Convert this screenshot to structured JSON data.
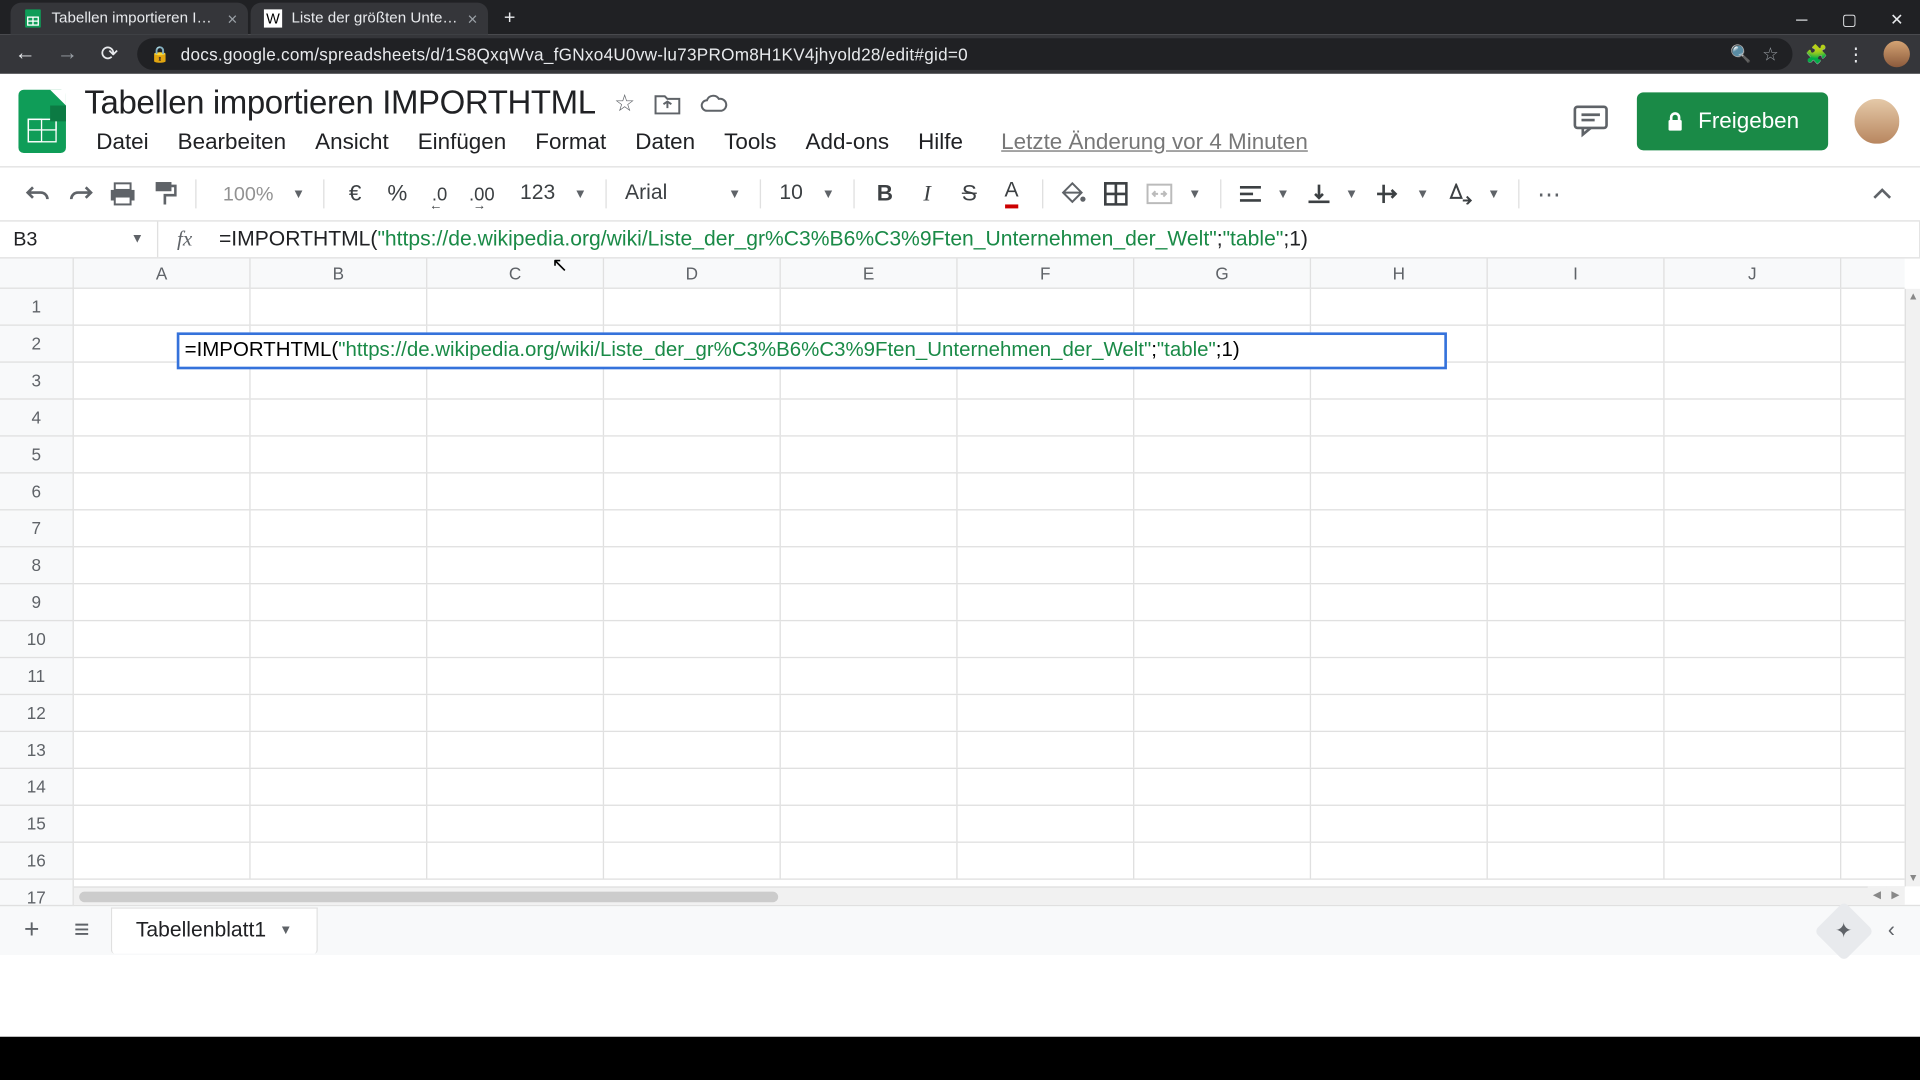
{
  "browser": {
    "tabs": [
      {
        "title": "Tabellen importieren IMPORTHT",
        "favicon": "sheets"
      },
      {
        "title": "Liste der größten Unternehmen",
        "favicon": "wiki"
      }
    ],
    "url": "docs.google.com/spreadsheets/d/1S8QxqWva_fGNxo4U0vw-lu73PROm8H1KV4jhyold28/edit#gid=0"
  },
  "header": {
    "doc_title": "Tabellen importieren IMPORTHTML",
    "menus": [
      "Datei",
      "Bearbeiten",
      "Ansicht",
      "Einfügen",
      "Format",
      "Daten",
      "Tools",
      "Add-ons",
      "Hilfe"
    ],
    "last_edit": "Letzte Änderung vor 4 Minuten",
    "share_label": "Freigeben"
  },
  "toolbar": {
    "zoom": "100%",
    "currency": "€",
    "percent": "%",
    "dec_less": ".0",
    "dec_more": ".00",
    "num_fmt": "123",
    "font": "Arial",
    "font_size": "10"
  },
  "formula_bar": {
    "cell_ref": "B3",
    "prefix": "=IMPORTHTML(",
    "str1": "\"https://de.wikipedia.org/wiki/Liste_der_gr%C3%B6%C3%9Ften_Unternehmen_der_Welt\"",
    "sep1": ";",
    "str2": "\"table\"",
    "sep2": ";1)"
  },
  "grid": {
    "columns": [
      "A",
      "B",
      "C",
      "D",
      "E",
      "F",
      "G",
      "H",
      "I",
      "J"
    ],
    "rows": [
      1,
      2,
      3,
      4,
      5,
      6,
      7,
      8,
      9,
      10,
      11,
      12,
      13,
      14,
      15,
      16,
      17
    ],
    "active_cell": {
      "ref": "B3",
      "prefix": "=IMPORTHTML(",
      "str1": "\"https://de.wikipedia.org/wiki/Liste_der_gr%C3%B6%C3%9Ften_Unternehmen_der_Welt\"",
      "sep1": ";",
      "str2": "\"table\"",
      "sep2": ";1)"
    }
  },
  "sheet_tabs": {
    "active": "Tabellenblatt1"
  }
}
